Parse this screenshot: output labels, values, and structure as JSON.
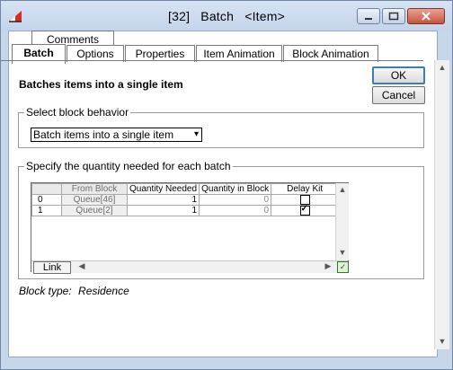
{
  "window": {
    "block_number": "[32]",
    "block_name": "Batch",
    "block_item": "<Item>"
  },
  "tabs": {
    "upper": [
      {
        "label": "Comments"
      }
    ],
    "lower": [
      {
        "label": "Batch",
        "active": true
      },
      {
        "label": "Options"
      },
      {
        "label": "Properties"
      },
      {
        "label": "Item Animation"
      },
      {
        "label": "Block Animation"
      }
    ]
  },
  "buttons": {
    "ok": "OK",
    "cancel": "Cancel",
    "link": "Link"
  },
  "description": "Batches items into a single item",
  "behavior_group": {
    "label": "Select block behavior",
    "selected": "Batch items into a single item"
  },
  "quantity_group": {
    "label": "Specify the quantity needed for each batch",
    "columns": [
      "From Block",
      "Quantity Needed",
      "Quantity in Block",
      "Delay Kit"
    ],
    "rows": [
      {
        "index": "0",
        "from": "Queue[46]",
        "needed": "1",
        "in_block": "0",
        "delay_kit": false
      },
      {
        "index": "1",
        "from": "Queue[2]",
        "needed": "1",
        "in_block": "0",
        "delay_kit": true
      }
    ]
  },
  "block_type": {
    "label": "Block type:",
    "value": "Residence"
  },
  "icons": {
    "app": "extendsim-app-icon",
    "minimize": "minimize-icon",
    "maximize": "maximize-icon",
    "close": "close-icon",
    "resize_table": "resize-table-icon"
  }
}
